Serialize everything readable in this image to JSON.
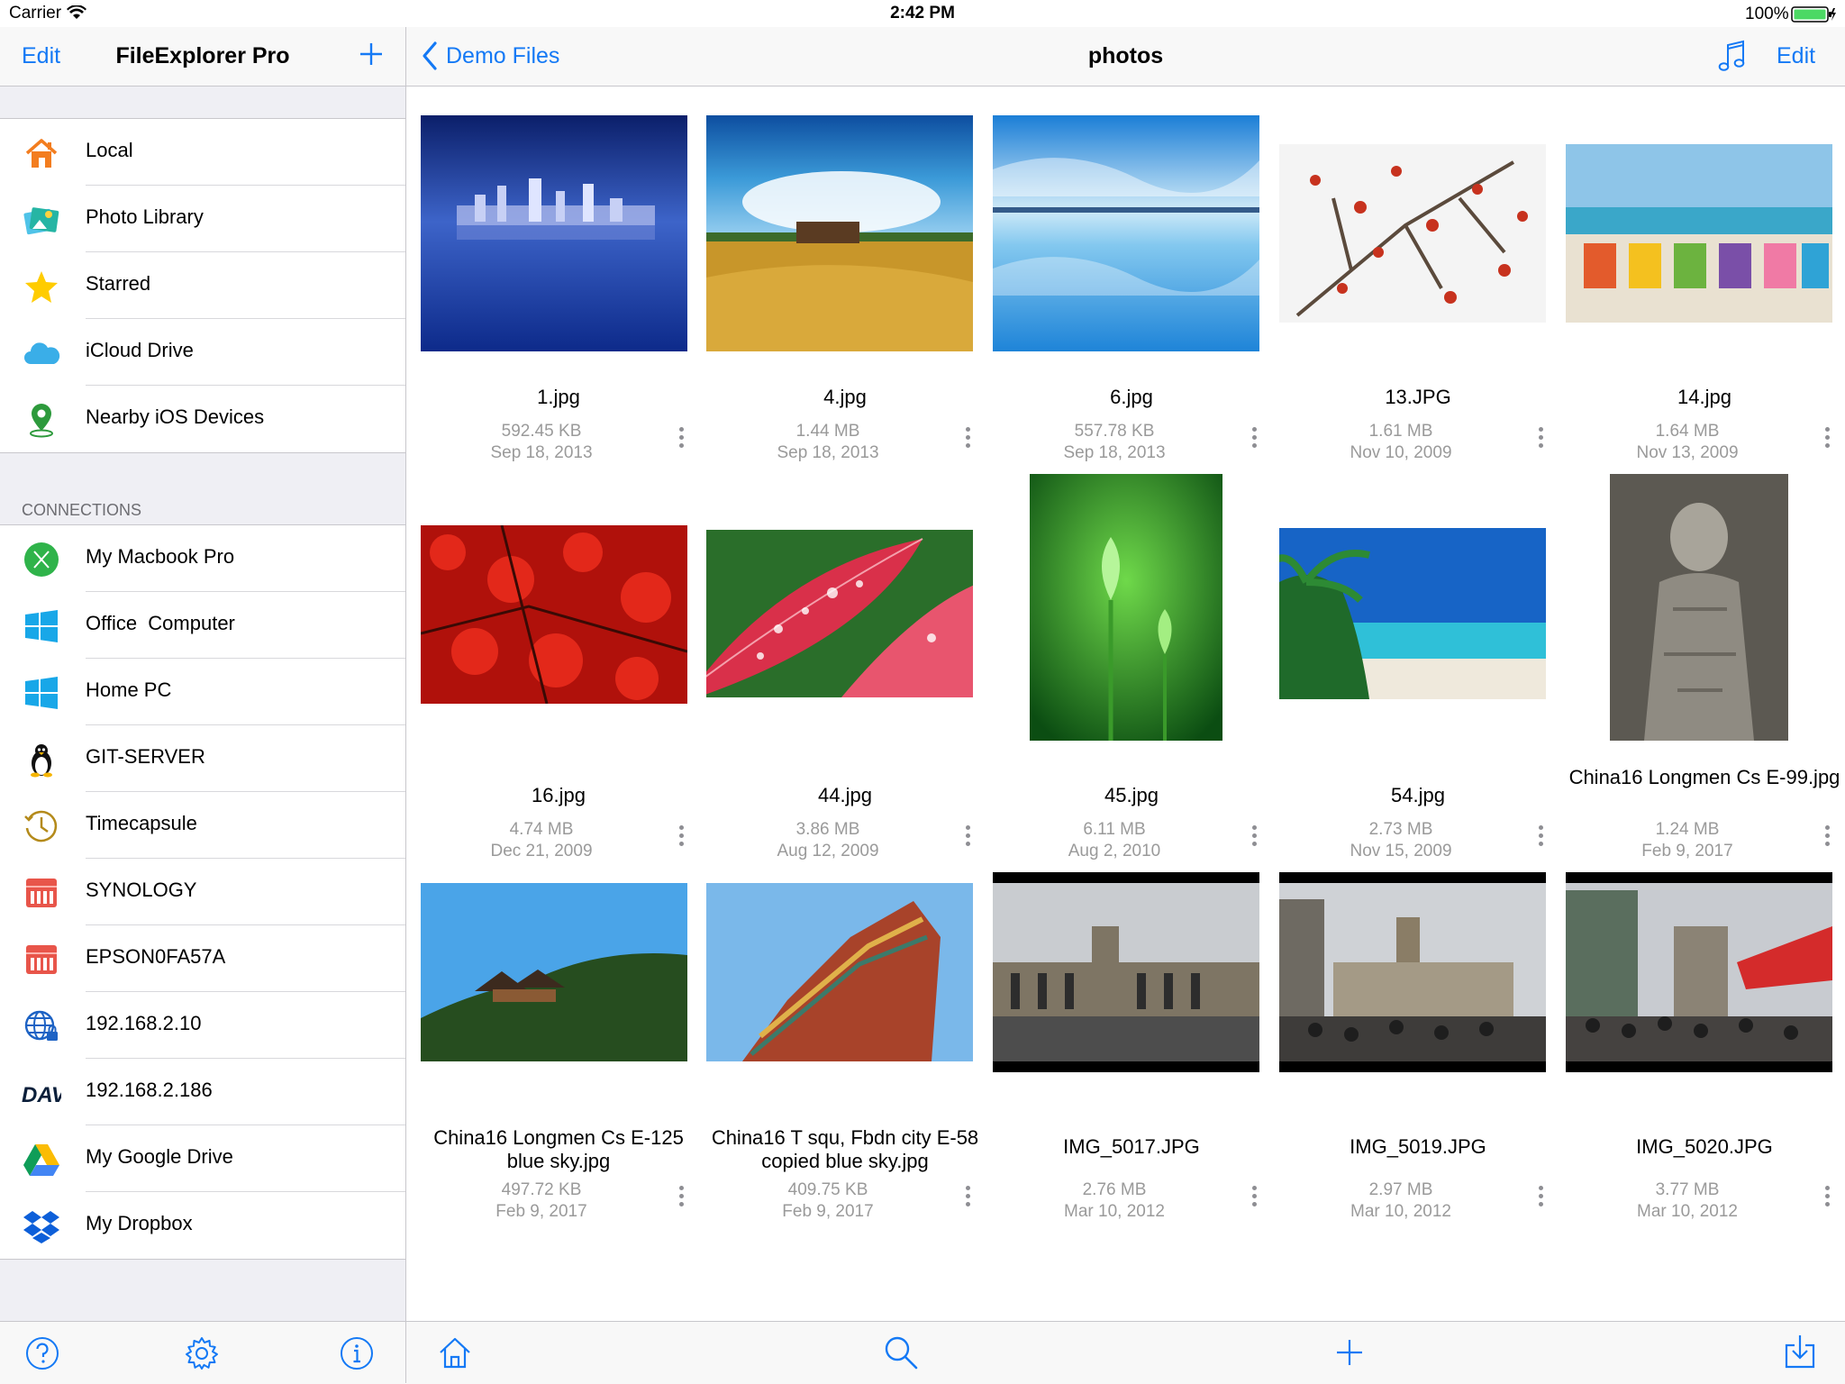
{
  "status_bar": {
    "carrier": "Carrier",
    "time": "2:42 PM",
    "battery": "100%"
  },
  "sidebar": {
    "edit_label": "Edit",
    "title": "FileExplorer Pro",
    "places": [
      {
        "label": "Local",
        "icon": "house-icon"
      },
      {
        "label": "Photo Library",
        "icon": "photo-library-icon"
      },
      {
        "label": "Starred",
        "icon": "star-icon"
      },
      {
        "label": "iCloud Drive",
        "icon": "cloud-icon"
      },
      {
        "label": "Nearby iOS Devices",
        "icon": "location-pin-icon"
      }
    ],
    "connections_header": "CONNECTIONS",
    "connections": [
      {
        "label": "My Macbook Pro",
        "icon": "mac-x-icon"
      },
      {
        "label": "Office  Computer",
        "icon": "windows-icon"
      },
      {
        "label": "Home PC",
        "icon": "windows-icon"
      },
      {
        "label": "GIT-SERVER",
        "icon": "linux-penguin-icon"
      },
      {
        "label": "Timecapsule",
        "icon": "clock-icon"
      },
      {
        "label": "SYNOLOGY",
        "icon": "nas-icon"
      },
      {
        "label": "EPSON0FA57A",
        "icon": "nas-icon"
      },
      {
        "label": "192.168.2.10",
        "icon": "globe-lock-icon"
      },
      {
        "label": "192.168.2.186",
        "icon": "dav-icon"
      },
      {
        "label": "My Google Drive",
        "icon": "google-drive-icon"
      },
      {
        "label": "My Dropbox",
        "icon": "dropbox-icon"
      }
    ]
  },
  "main": {
    "back_label": "Demo Files",
    "title": "photos",
    "edit_label": "Edit",
    "files": [
      {
        "name": "1.jpg",
        "size": "592.45 KB",
        "date": "Sep 18, 2013"
      },
      {
        "name": "4.jpg",
        "size": "1.44 MB",
        "date": "Sep 18, 2013"
      },
      {
        "name": "6.jpg",
        "size": "557.78 KB",
        "date": "Sep 18, 2013"
      },
      {
        "name": "13.JPG",
        "size": "1.61 MB",
        "date": "Nov 10, 2009"
      },
      {
        "name": "14.jpg",
        "size": "1.64 MB",
        "date": "Nov 13, 2009"
      },
      {
        "name": "16.jpg",
        "size": "4.74 MB",
        "date": "Dec 21, 2009"
      },
      {
        "name": "44.jpg",
        "size": "3.86 MB",
        "date": "Aug 12, 2009"
      },
      {
        "name": "45.jpg",
        "size": "6.11 MB",
        "date": "Aug 2, 2010"
      },
      {
        "name": "54.jpg",
        "size": "2.73 MB",
        "date": "Nov 15, 2009"
      },
      {
        "name": "China16 Longmen Cs E-99.jpg",
        "size": "1.24 MB",
        "date": "Feb 9, 2017"
      },
      {
        "name": "China16 Longmen Cs E-125 blue sky.jpg",
        "size": "497.72 KB",
        "date": "Feb 9, 2017"
      },
      {
        "name": "China16 T squ, Fbdn city E-58 copied blue sky.jpg",
        "size": "409.75 KB",
        "date": "Feb 9, 2017"
      },
      {
        "name": "IMG_5017.JPG",
        "size": "2.76 MB",
        "date": "Mar 10, 2012"
      },
      {
        "name": "IMG_5019.JPG",
        "size": "2.97 MB",
        "date": "Mar 10, 2012"
      },
      {
        "name": "IMG_5020.JPG",
        "size": "3.77 MB",
        "date": "Mar 10, 2012"
      }
    ]
  },
  "colors": {
    "accent": "#1479f5",
    "secondary_text": "#9a9a9a",
    "separator": "#c8c7cc"
  }
}
